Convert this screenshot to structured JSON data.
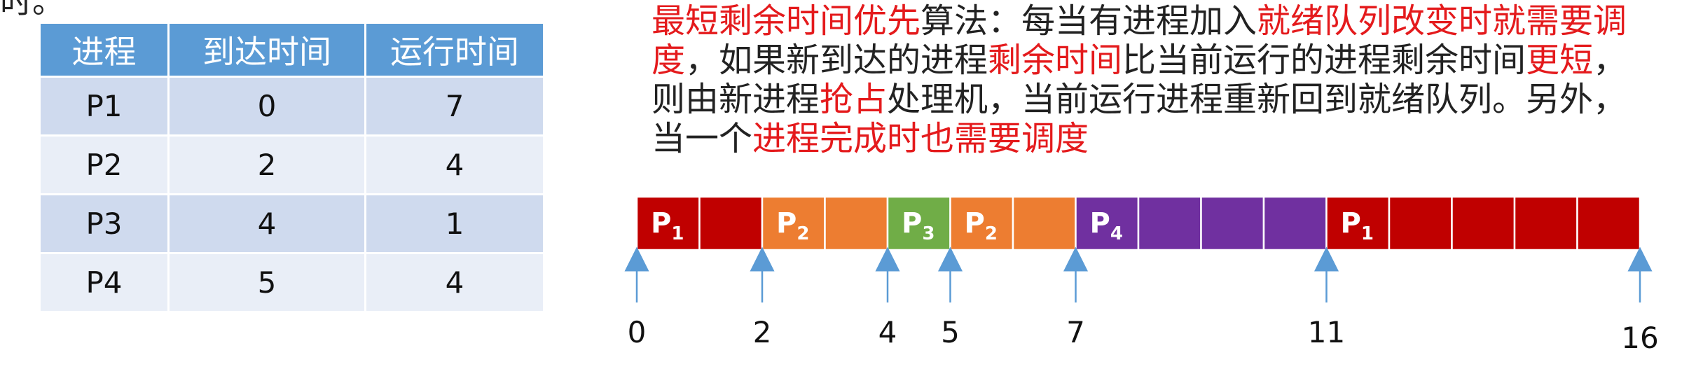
{
  "cropped_text": "时。",
  "table": {
    "headers": [
      "进程",
      "到达时间",
      "运行时间"
    ],
    "rows": [
      [
        "P1",
        "0",
        "7"
      ],
      [
        "P2",
        "2",
        "4"
      ],
      [
        "P3",
        "4",
        "1"
      ],
      [
        "P4",
        "5",
        "4"
      ]
    ]
  },
  "description": [
    {
      "text": "最短剩余时间优先",
      "highlight": true
    },
    {
      "text": "算法：每当有进程加入",
      "highlight": false
    },
    {
      "text": "就绪队列改变时就需要调度",
      "highlight": true
    },
    {
      "text": "，如果新到达的进程",
      "highlight": false
    },
    {
      "text": "剩余时间",
      "highlight": true
    },
    {
      "text": "比当前运行的进程剩余时间",
      "highlight": false
    },
    {
      "text": "更短",
      "highlight": true
    },
    {
      "text": "，则由新进程",
      "highlight": false
    },
    {
      "text": "抢占",
      "highlight": true
    },
    {
      "text": "处理机，当前运行进程重新回到就绪队列。另外，当一个",
      "highlight": false
    },
    {
      "text": "进程完成时也需要调度",
      "highlight": true
    }
  ],
  "gantt": {
    "time_start": 0,
    "time_end": 16,
    "colors": {
      "P1": "#c00000",
      "P2": "#ed7d31",
      "P3": "#70ad47",
      "P4": "#7030a0"
    },
    "segments": [
      {
        "process": "P1",
        "start": 0,
        "end": 2
      },
      {
        "process": "P2",
        "start": 2,
        "end": 4
      },
      {
        "process": "P3",
        "start": 4,
        "end": 5
      },
      {
        "process": "P2",
        "start": 5,
        "end": 7
      },
      {
        "process": "P4",
        "start": 7,
        "end": 11
      },
      {
        "process": "P1",
        "start": 11,
        "end": 16
      }
    ],
    "markers": [
      "0",
      "2",
      "4",
      "5",
      "7",
      "11",
      "16"
    ]
  }
}
